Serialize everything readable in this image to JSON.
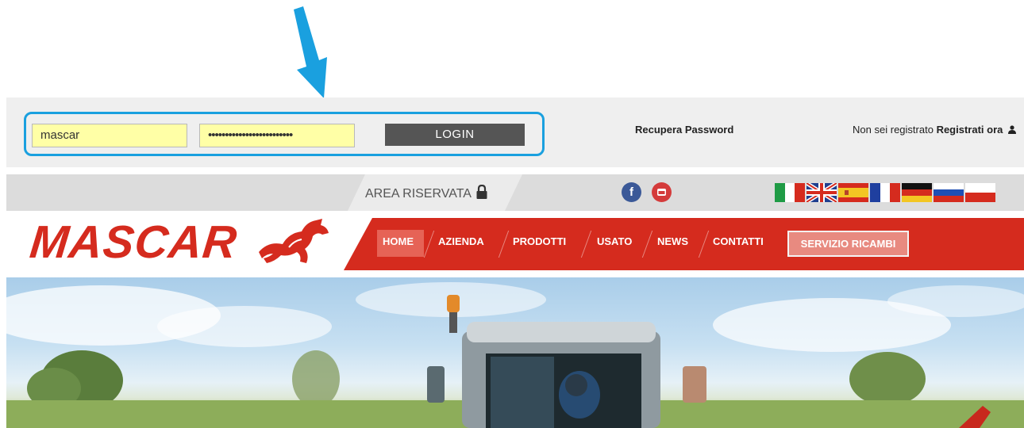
{
  "login": {
    "username_value": "mascar",
    "password_value": "•••••••••••••••••••••••••",
    "login_label": "LOGIN",
    "recover_label": "Recupera Password",
    "register_prompt": "Non sei registrato",
    "register_link": "Registrati ora"
  },
  "topbar": {
    "reserved_area_label": "AREA RISERVATA",
    "social_icons": [
      "facebook-icon",
      "youtube-icon"
    ],
    "languages": [
      "it",
      "en",
      "es",
      "fr",
      "de",
      "ru",
      "pl"
    ]
  },
  "brand": {
    "logo_text": "MASCAR"
  },
  "nav": {
    "items": [
      "HOME",
      "AZIENDA",
      "PRODOTTI",
      "USATO",
      "NEWS",
      "CONTATTI"
    ],
    "active_item": "HOME",
    "service_button": "SERVIZIO RICAMBI"
  },
  "colors": {
    "brand_red": "#d52b1e",
    "highlight_blue": "#1aa0df",
    "input_yellow": "#ffffa6",
    "login_button": "#555555"
  }
}
